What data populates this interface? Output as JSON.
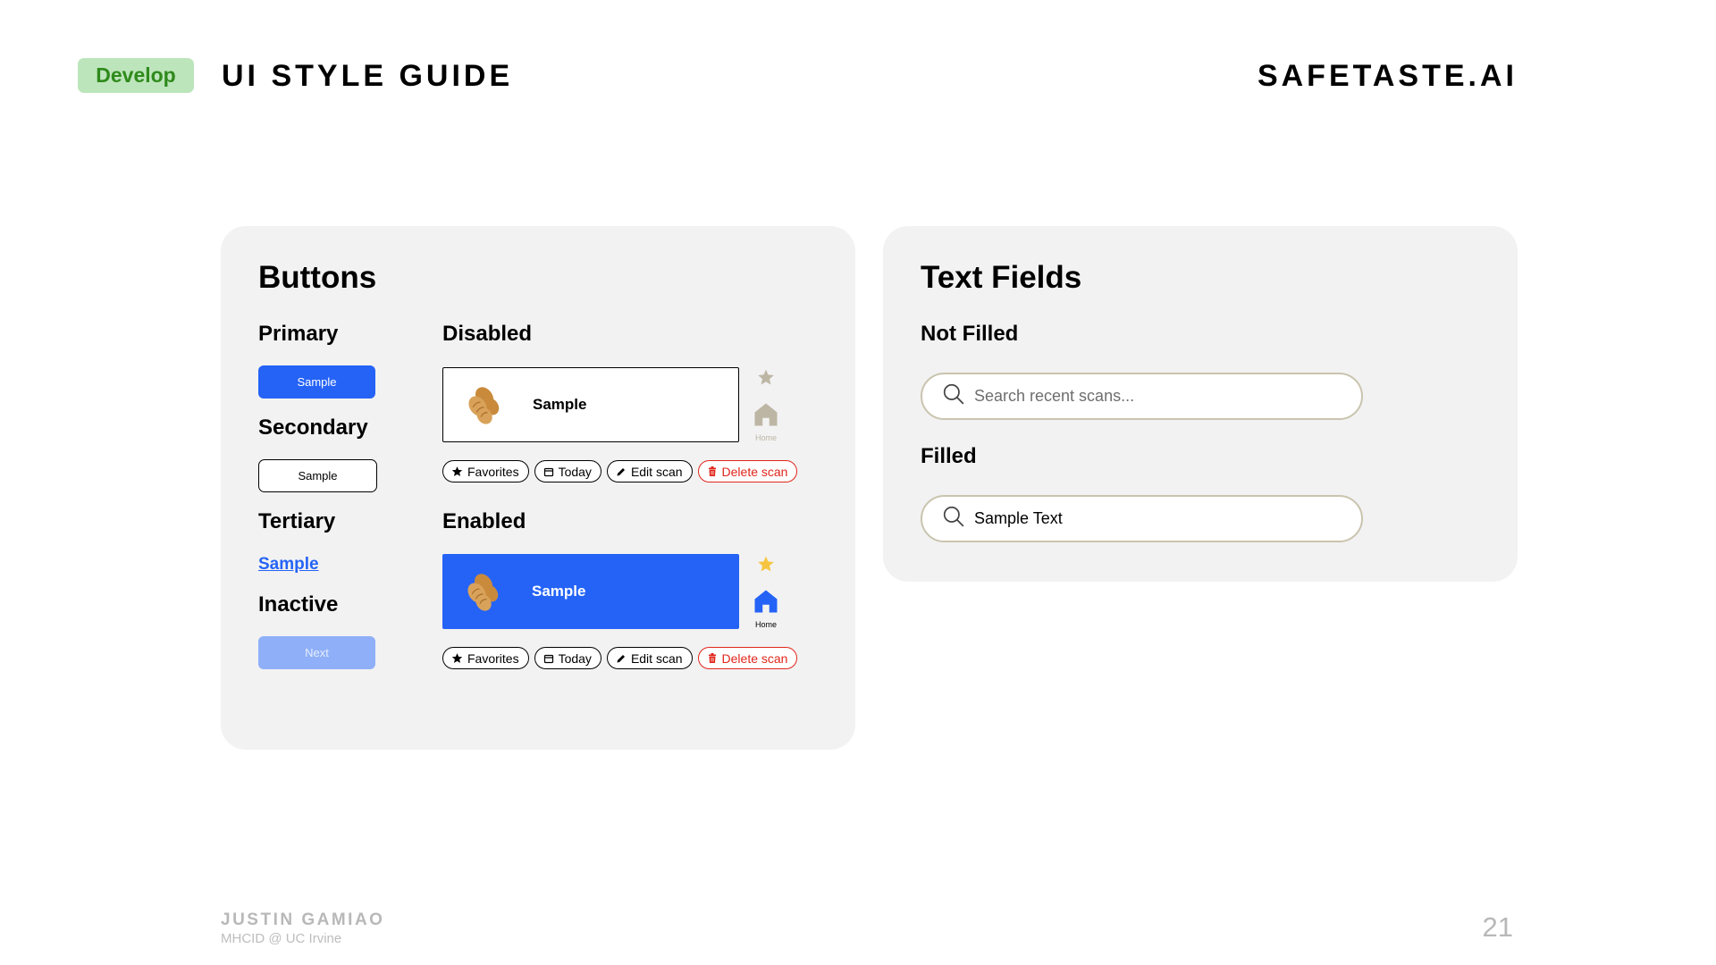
{
  "header": {
    "tag": "Develop",
    "title": "UI STYLE GUIDE",
    "brand": "SAFETASTE.AI"
  },
  "buttons_card": {
    "title": "Buttons",
    "primary": {
      "heading": "Primary",
      "label": "Sample"
    },
    "secondary": {
      "heading": "Secondary",
      "label": "Sample"
    },
    "tertiary": {
      "heading": "Tertiary",
      "label": "Sample"
    },
    "inactive": {
      "heading": "Inactive",
      "label": "Next"
    },
    "disabled": {
      "heading": "Disabled",
      "card_label": "Sample",
      "home_label": "Home",
      "chips": [
        "Favorites",
        "Today",
        "Edit scan",
        "Delete scan"
      ]
    },
    "enabled": {
      "heading": "Enabled",
      "card_label": "Sample",
      "home_label": "Home",
      "chips": [
        "Favorites",
        "Today",
        "Edit scan",
        "Delete scan"
      ]
    }
  },
  "fields_card": {
    "title": "Text Fields",
    "not_filled": {
      "heading": "Not Filled",
      "placeholder": "Search recent scans..."
    },
    "filled": {
      "heading": "Filled",
      "value": "Sample Text"
    }
  },
  "footer": {
    "author": "JUSTIN GAMIAO",
    "affiliation": "MHCID @ UC Irvine",
    "page": "21"
  },
  "colors": {
    "primary_blue": "#2563f6",
    "inactive_blue": "#8fb0f8",
    "danger_red": "#e0261b",
    "card_bg": "#f2f2f2",
    "tag_bg": "#bde5bb",
    "tag_text": "#2f8a1c",
    "star_gold": "#f5c542",
    "star_gray": "#bdb6a4"
  },
  "icons": [
    "peanut-icon",
    "star-icon",
    "home-icon",
    "calendar-icon",
    "pencil-icon",
    "trash-icon",
    "search-icon"
  ]
}
